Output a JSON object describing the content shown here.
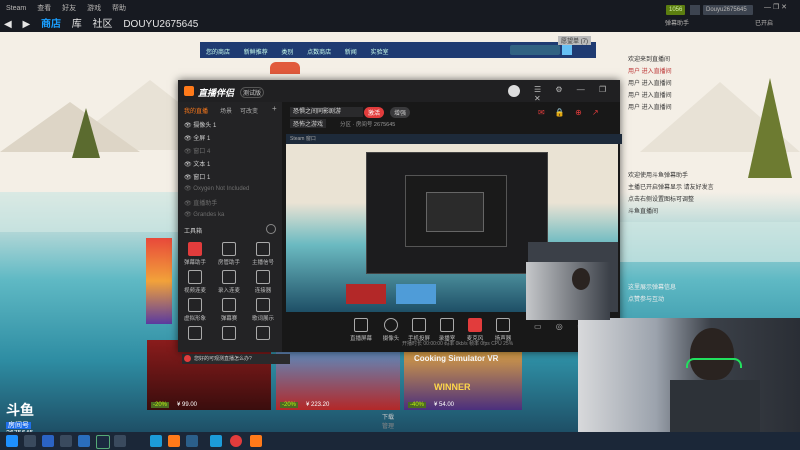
{
  "steam": {
    "menu": [
      "Steam",
      "查看",
      "好友",
      "游戏",
      "帮助"
    ],
    "nav": [
      "商店",
      "库",
      "社区",
      "DOUYU2675645"
    ],
    "user": "Douyu2675645",
    "right_links": [
      "弹幕助手",
      "已开启"
    ],
    "badge_green": "1056",
    "store_bar": [
      "您的商店",
      "新鲜推荐",
      "类别",
      "点数商店",
      "新闻",
      "实验室"
    ],
    "store_bar_right": "愿望单 (7)"
  },
  "obs": {
    "title": "直播伴侣",
    "title_badge": "测试版",
    "left_tabs": [
      "我的直播",
      "场景",
      "可改变"
    ],
    "sources": [
      {
        "label": "摄像头 1",
        "dim": false
      },
      {
        "label": "全屏 1",
        "dim": false
      },
      {
        "label": "窗口 4",
        "dim": true
      },
      {
        "label": "文本 1",
        "dim": false
      },
      {
        "label": "窗口 1",
        "dim": false
      },
      {
        "label": "Oxygen Not Included",
        "dim": true
      },
      {
        "label": "直播助手",
        "dim": true
      },
      {
        "label": "Grandes ka",
        "dim": true
      }
    ],
    "toolbox_title": "工具箱",
    "tools": [
      "弹幕助手",
      "房管助手",
      "主播信号",
      "视频连麦",
      "录入连麦",
      "连接器",
      "虚拟形象",
      "弹幕赛",
      "歌词展示",
      "",
      "",
      ""
    ],
    "stream_title": "恐惧之间同影剧游",
    "pill_red": "激活",
    "pill_grey": "增强",
    "category": "恐怖之游戏",
    "info_line": "分区 · 房间号 2675645",
    "bottom_tools": [
      "直播屏幕",
      "摄像头",
      "手机投屏",
      "录播室",
      "麦克风",
      "扬声器"
    ],
    "status_line": "开播时长 00:00:00   码率 0kb/s   帧率 0fps   CPU 25%",
    "hint": "您好的可观测直播怎么办?",
    "steam_small_label": "Steam 窗口"
  },
  "chat": {
    "lines": [
      "欢迎来到直播间",
      "用户 进入直播间",
      "用户 进入直播间",
      "用户 进入直播间",
      "用户 进入直播间",
      "欢迎使用斗鱼弹幕助手",
      "主播已开启弹幕显示 请友好发言",
      "点击右侧设置图标可调整",
      "斗鱼直播间",
      "这里展示弹幕信息",
      "点赞参与互动"
    ]
  },
  "stream_overlay": {
    "room_label": "斗鱼",
    "room_tag": "房间号",
    "room_number": "2675645"
  },
  "games": {
    "prices": [
      "¥ 99.00",
      "¥ 223.20",
      "¥ 54.00"
    ],
    "discounts": [
      "-20%",
      "-20%",
      "-40%"
    ],
    "tile_text": "WINNER",
    "cooking_text": "Cooking Simulator VR",
    "more_label": "下载",
    "more_sub": "管理"
  },
  "colors": {
    "steam_dark": "#171a21",
    "accent_red": "#e23c3c",
    "accent_orange": "#ff7a1a"
  }
}
